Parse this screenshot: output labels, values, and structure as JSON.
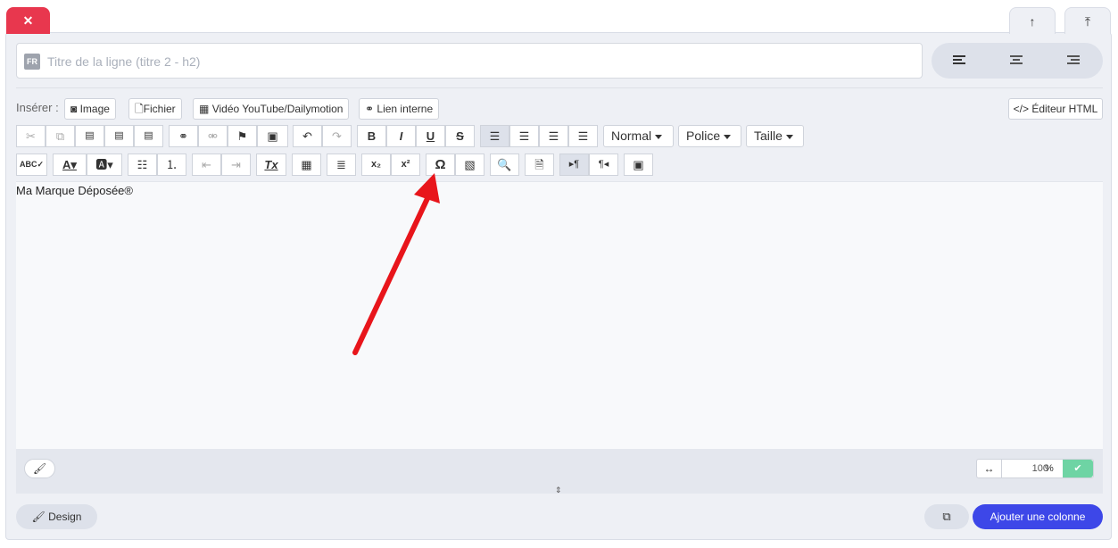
{
  "tabs": {
    "close_glyph": "✕",
    "up_glyph": "↑",
    "top_glyph": "⤒"
  },
  "title": {
    "lang_badge": "FR",
    "placeholder": "Titre de la ligne (titre 2 - h2)",
    "value": ""
  },
  "insert": {
    "label": "Insérer :",
    "buttons": [
      {
        "icon": "camera-icon",
        "label": "Image"
      },
      {
        "icon": "file-icon",
        "label": "Fichier"
      },
      {
        "icon": "film-icon",
        "label": "Vidéo YouTube/Dailymotion"
      },
      {
        "icon": "link-icon",
        "label": "Lien interne"
      }
    ],
    "html_editor": "Éditeur HTML"
  },
  "toolbar": {
    "format": "Normal",
    "font": "Police",
    "size": "Taille",
    "icons": {
      "cut": "✂",
      "copy": "⧉",
      "paste": "📋",
      "undo": "↶",
      "redo": "↷",
      "bold": "B",
      "italic": "I",
      "underline": "U",
      "strike": "S",
      "omega": "Ω",
      "subscript": "x₂",
      "superscript": "x²"
    }
  },
  "editor": {
    "content": "Ma Marque Déposée®"
  },
  "bottom": {
    "width_value": "100",
    "width_unit": "%",
    "check_glyph": "✔",
    "design_label": "Design",
    "add_column_label": "Ajouter une colonne"
  },
  "colors": {
    "danger": "#e8374e",
    "primary": "#3d47e8",
    "success": "#6ed4a4",
    "arrow": "#e8151b"
  }
}
